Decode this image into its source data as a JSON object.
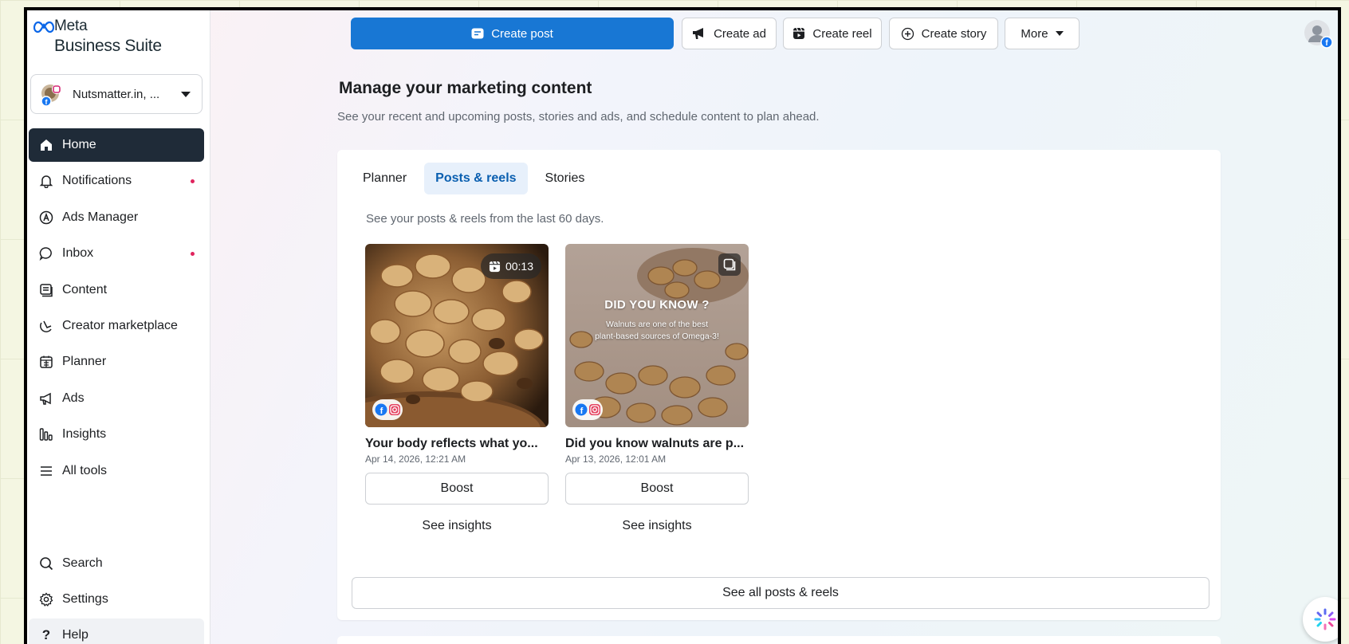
{
  "brand": {
    "line1": "Meta",
    "line2": "Business Suite"
  },
  "account": {
    "name": "Nutsmatter.in, ..."
  },
  "nav": {
    "items": [
      {
        "label": "Home",
        "icon": "home-icon",
        "active": true
      },
      {
        "label": "Notifications",
        "icon": "bell-icon",
        "dot": true
      },
      {
        "label": "Ads Manager",
        "icon": "ads-manager-icon"
      },
      {
        "label": "Inbox",
        "icon": "chat-bubble-icon",
        "dot": true
      },
      {
        "label": "Content",
        "icon": "content-icon"
      },
      {
        "label": "Creator marketplace",
        "icon": "creator-icon"
      },
      {
        "label": "Planner",
        "icon": "calendar-icon"
      },
      {
        "label": "Ads",
        "icon": "megaphone-icon"
      },
      {
        "label": "Insights",
        "icon": "bar-chart-icon"
      },
      {
        "label": "All tools",
        "icon": "menu-icon"
      }
    ],
    "bottom": [
      {
        "label": "Search",
        "icon": "search-icon"
      },
      {
        "label": "Settings",
        "icon": "gear-icon"
      },
      {
        "label": "Help",
        "icon": "help-icon"
      }
    ]
  },
  "toolbar": {
    "create_post": "Create post",
    "create_ad": "Create ad",
    "create_reel": "Create reel",
    "create_story": "Create story",
    "more": "More"
  },
  "main": {
    "title": "Manage your marketing content",
    "subtitle": "See your recent and upcoming posts, stories and ads, and schedule content to plan ahead.",
    "tabs": [
      {
        "label": "Planner",
        "selected": false
      },
      {
        "label": "Posts & reels",
        "selected": true
      },
      {
        "label": "Stories",
        "selected": false
      }
    ],
    "hint": "See your posts & reels from the last 60 days.",
    "posts": [
      {
        "title": "Your body reflects what yo...",
        "date": "Apr 14, 2026, 12:21 AM",
        "duration": "00:13",
        "boost": "Boost",
        "insights": "See insights"
      },
      {
        "title": "Did you know walnuts are p...",
        "date": "Apr 13, 2026, 12:01 AM",
        "overlay_title": "DID YOU KNOW ?",
        "overlay_line1": "Walnuts are one of the best",
        "overlay_line2": "plant-based sources of Omega-3!",
        "boost": "Boost",
        "insights": "See insights"
      }
    ],
    "see_all": "See all posts & reels"
  },
  "colors": {
    "primary": "#1877d4",
    "active_nav": "#1f2b38",
    "notification_dot": "#e0245e",
    "selected_tab_bg": "#e7f0fb"
  }
}
